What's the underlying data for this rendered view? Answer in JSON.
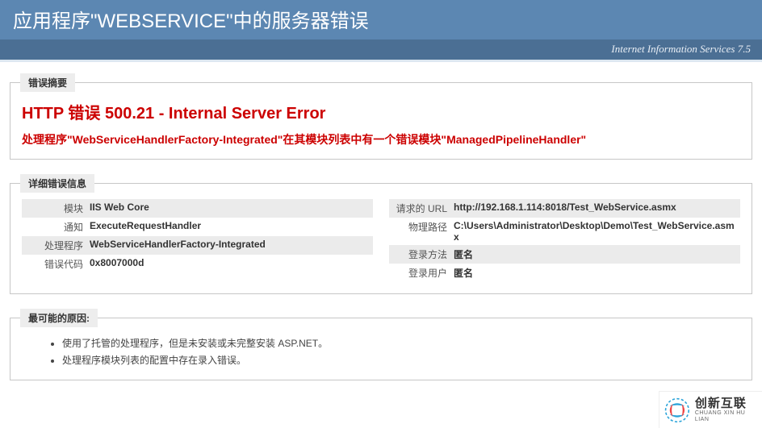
{
  "header": {
    "title": "应用程序\"WEBSERVICE\"中的服务器错误",
    "subtitle": "Internet Information Services 7.5"
  },
  "summary": {
    "legend": "错误摘要",
    "error_title": "HTTP 错误 500.21 - Internal Server Error",
    "error_sub": "处理程序\"WebServiceHandlerFactory-Integrated\"在其模块列表中有一个错误模块\"ManagedPipelineHandler\""
  },
  "details": {
    "legend": "详细错误信息",
    "left": [
      {
        "label": "模块",
        "value": "IIS Web Core",
        "alt": true
      },
      {
        "label": "通知",
        "value": "ExecuteRequestHandler",
        "alt": false
      },
      {
        "label": "处理程序",
        "value": "WebServiceHandlerFactory-Integrated",
        "alt": true
      },
      {
        "label": "错误代码",
        "value": "0x8007000d",
        "alt": false
      }
    ],
    "right": [
      {
        "label": "请求的 URL",
        "value": "http://192.168.1.114:8018/Test_WebService.asmx",
        "alt": true
      },
      {
        "label": "物理路径",
        "value": "C:\\Users\\Administrator\\Desktop\\Demo\\Test_WebService.asmx",
        "alt": false
      },
      {
        "label": "登录方法",
        "value": "匿名",
        "alt": true
      },
      {
        "label": "登录用户",
        "value": "匿名",
        "alt": false
      }
    ]
  },
  "causes": {
    "legend": "最可能的原因:",
    "items": [
      "使用了托管的处理程序，但是未安装或未完整安装 ASP.NET。",
      "处理程序模块列表的配置中存在录入错误。"
    ]
  },
  "watermark": {
    "cn": "创新互联",
    "pinyin": "CHUANG XIN HU LIAN"
  }
}
